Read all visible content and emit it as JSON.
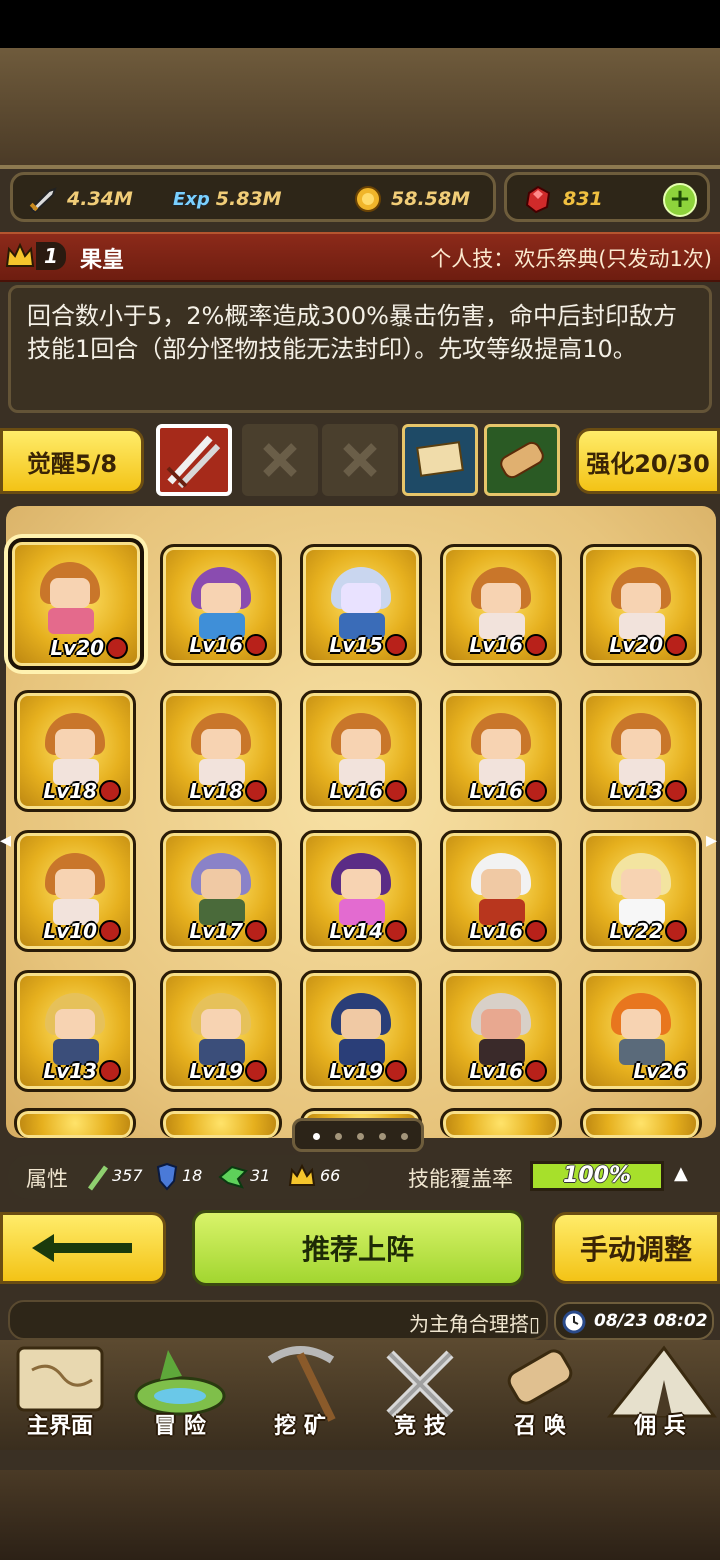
{
  "resources": {
    "attack": "4.34M",
    "exp": "5.83M",
    "gold": "58.58M",
    "gems": "831"
  },
  "hero": {
    "rank": "1",
    "name": "果皇",
    "skill_title": "个人技：欢乐祭典(只发动1次)",
    "description": "回合数小于5，2%概率造成300%暴击伤害，命中后封印敌方技能1回合（部分怪物技能无法封印）。先攻等级提高10。"
  },
  "awaken": {
    "label": "觉醒5/8"
  },
  "enhance": {
    "label": "强化20/30"
  },
  "heroes": [
    {
      "level": "Lv20",
      "hair": "#c9762a",
      "outfit": "#e46a8c",
      "skin": "#f7d3b2",
      "selected": true
    },
    {
      "level": "Lv16",
      "hair": "#8a4cb0",
      "outfit": "#3f8fd8",
      "skin": "#f7d3b2"
    },
    {
      "level": "Lv15",
      "hair": "#c9d6ef",
      "outfit": "#3a6cb8",
      "skin": "#e9e2ff"
    },
    {
      "level": "Lv16",
      "hair": "#c9762a",
      "outfit": "#f2e3dc",
      "skin": "#f7d3b2"
    },
    {
      "level": "Lv20",
      "hair": "#c9762a",
      "outfit": "#f2e3dc",
      "skin": "#f7d3b2"
    },
    {
      "level": "Lv18",
      "hair": "#c9762a",
      "outfit": "#f2e3dc",
      "skin": "#f7d3b2"
    },
    {
      "level": "Lv18",
      "hair": "#c9762a",
      "outfit": "#f2e3dc",
      "skin": "#f7d3b2"
    },
    {
      "level": "Lv16",
      "hair": "#c9762a",
      "outfit": "#f2e3dc",
      "skin": "#f7d3b2"
    },
    {
      "level": "Lv16",
      "hair": "#c9762a",
      "outfit": "#f2e3dc",
      "skin": "#f7d3b2"
    },
    {
      "level": "Lv13",
      "hair": "#c9762a",
      "outfit": "#f2e3dc",
      "skin": "#f7d3b2"
    },
    {
      "level": "Lv10",
      "hair": "#c9762a",
      "outfit": "#f2e3dc",
      "skin": "#f7d3b2"
    },
    {
      "level": "Lv17",
      "hair": "#8a82c8",
      "outfit": "#4a6a3a",
      "skin": "#f0c9a4"
    },
    {
      "level": "Lv14",
      "hair": "#5b2c86",
      "outfit": "#e36bd0",
      "skin": "#f7d3b2"
    },
    {
      "level": "Lv16",
      "hair": "#f2f2f2",
      "outfit": "#b8361e",
      "skin": "#f0c9a4"
    },
    {
      "level": "Lv22",
      "hair": "#f3e4a0",
      "outfit": "#f7f7f7",
      "skin": "#f7d3b2"
    },
    {
      "level": "Lv13",
      "hair": "#e6c15a",
      "outfit": "#3b4e7a",
      "skin": "#f7d3b2"
    },
    {
      "level": "Lv19",
      "hair": "#e6c15a",
      "outfit": "#3b4e7a",
      "skin": "#f7d3b2"
    },
    {
      "level": "Lv19",
      "hair": "#2a3e78",
      "outfit": "#2a3e78",
      "skin": "#f0c9a4"
    },
    {
      "level": "Lv16",
      "hair": "#d8d0c8",
      "outfit": "#3a2a2a",
      "skin": "#e8a890"
    },
    {
      "level": "Lv26",
      "hair": "#e8761e",
      "outfit": "#5a6a7a",
      "skin": "#f7d3b2",
      "locked": true
    }
  ],
  "attributes": {
    "label": "属性",
    "a": "357",
    "b": "18",
    "c": "31",
    "d": "66"
  },
  "coverage": {
    "label": "技能覆盖率",
    "value": "100%"
  },
  "buttons": {
    "recommend": "推荐上阵",
    "manual": "手动调整"
  },
  "message": "为主角合理搭▯",
  "time": "08/23 08:02",
  "nav": [
    {
      "label": "主界面"
    },
    {
      "label": "冒 险"
    },
    {
      "label": "挖 矿"
    },
    {
      "label": "竞 技"
    },
    {
      "label": "召 唤"
    },
    {
      "label": "佣 兵"
    }
  ],
  "colors": {
    "accent_green": "#a7e02b",
    "gold": "#f1cd78",
    "banner_red": "#7a2212"
  }
}
